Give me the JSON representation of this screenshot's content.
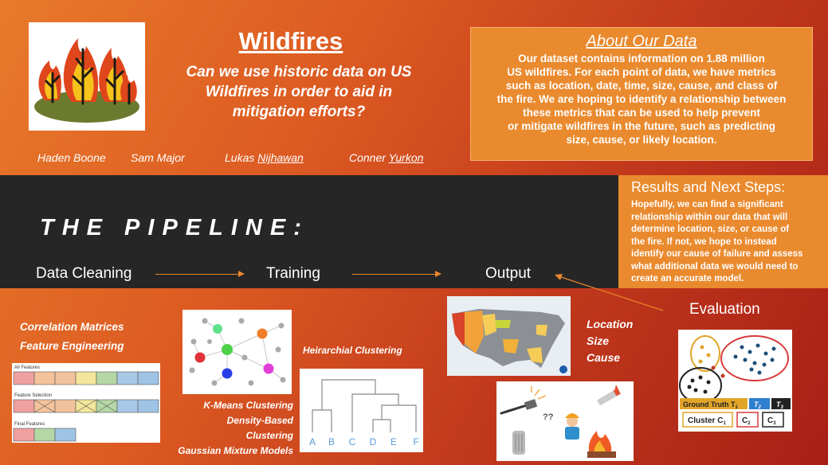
{
  "header": {
    "title": "Wildfires",
    "subtitle_lines": [
      "Can we use historic data on US",
      "Wildfires in order to aid in",
      "mitigation efforts?"
    ]
  },
  "authors": [
    {
      "first": "Haden",
      "last": "Boone"
    },
    {
      "first": "Sam",
      "last": "Major"
    },
    {
      "first": "Lukas",
      "last": "Nijhawan"
    },
    {
      "first": "Conner",
      "last": "Yurkon"
    }
  ],
  "about": {
    "title": "About Our Data",
    "lines": [
      "Our dataset contains information on 1.88 million",
      "US wildfires.  For each point of data, we have metrics",
      "such as location, date, time, size, cause, and class of",
      "the fire.  We are hoping to identify a relationship between",
      "these metrics that can be used to help prevent",
      "or mitigate wildfires in the future, such as predicting",
      "size, cause, or likely location."
    ]
  },
  "pipeline": {
    "heading": "THE PIPELINE:",
    "stages": [
      "Data Cleaning",
      "Training",
      "Output"
    ]
  },
  "results": {
    "title": "Results and Next Steps:",
    "lines": [
      "Hopefully, we can find a significant",
      "relationship within our data that will",
      "determine location, size, or cause of",
      "the fire.  If not, we hope to instead",
      "identify our cause of failure and assess",
      "what additional data we would need to",
      "create an accurate model."
    ]
  },
  "evaluation": "Evaluation",
  "data_cleaning": {
    "labels": [
      "Correlation Matrices",
      "Feature Engineering"
    ],
    "diagram": {
      "rows": [
        {
          "label": "All Features"
        },
        {
          "label": "Feature Selection"
        },
        {
          "label": "Final Features"
        }
      ]
    }
  },
  "training": {
    "clustering_methods": [
      "K-Means Clustering",
      "Density-Based Clustering",
      "Gaussian Mixture Models"
    ],
    "hierarchical_label": "Heirarchial Clustering",
    "dendrogram_leaves": [
      "A",
      "B",
      "C",
      "D",
      "E",
      "F"
    ]
  },
  "output": {
    "targets": [
      "Location",
      "Size",
      "Cause"
    ],
    "icon_text": "??"
  },
  "eval_figure": {
    "ground_truth": "Ground Truth T",
    "t_labels": [
      "T",
      "T"
    ],
    "t_subs": [
      "1",
      "2",
      "3"
    ],
    "cluster": "Cluster C",
    "c_labels": [
      "C",
      "C"
    ],
    "c_subs": [
      "1",
      "2",
      "3"
    ]
  },
  "colors": {
    "accent_orange": "#ea8a2e",
    "band_dark": "#262626",
    "arrow": "#e8862c"
  }
}
